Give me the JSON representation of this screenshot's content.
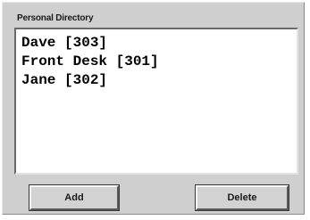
{
  "directory": {
    "title": "Personal Directory",
    "entries": [
      "Dave [303]",
      "Front Desk [301]",
      "Jane [302]"
    ]
  },
  "buttons": {
    "add_label": "Add",
    "delete_label": "Delete"
  }
}
